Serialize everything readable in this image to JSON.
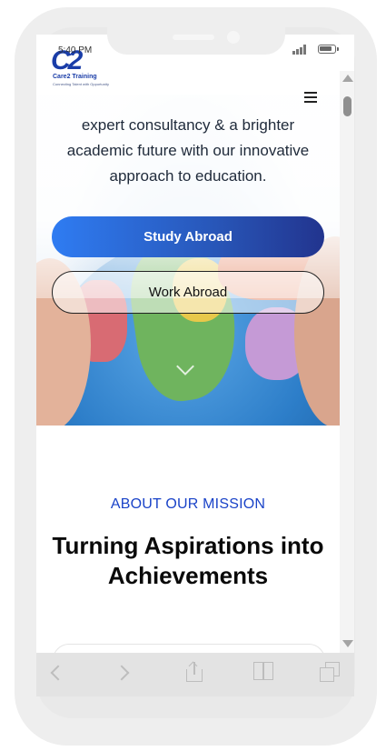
{
  "status_bar": {
    "time": "5:40 PM"
  },
  "header": {
    "logo_mark": "C2",
    "logo_name": "Care2 Training",
    "logo_tagline": "Connecting Talent with Opportunity"
  },
  "hero": {
    "text": "expert consultancy & a brighter academic future with our innovative approach to education.",
    "study_button": "Study Abroad",
    "work_button": "Work Abroad"
  },
  "about": {
    "label": "ABOUT OUR MISSION",
    "title": "Turning Aspirations into Achievements"
  },
  "colors": {
    "accent": "#1a43c8",
    "button_gradient_start": "#2f7cf2",
    "button_gradient_end": "#22348e"
  },
  "icons": {
    "menu": "hamburger-menu-icon",
    "back": "chevron-left-icon",
    "forward": "chevron-right-icon",
    "share": "share-icon",
    "bookmarks": "book-icon",
    "tabs": "tabs-icon"
  }
}
